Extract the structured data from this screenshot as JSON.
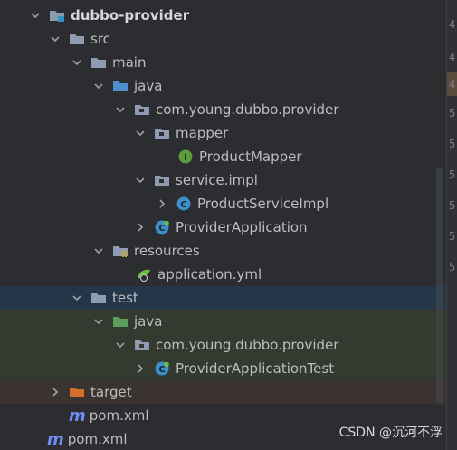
{
  "tree": {
    "rows": [
      {
        "label": "dubbo-provider"
      },
      {
        "label": "src"
      },
      {
        "label": "main"
      },
      {
        "label": "java"
      },
      {
        "label": "com.young.dubbo.provider"
      },
      {
        "label": "mapper"
      },
      {
        "label": "ProductMapper"
      },
      {
        "label": "service.impl"
      },
      {
        "label": "ProductServiceImpl"
      },
      {
        "label": "ProviderApplication"
      },
      {
        "label": "resources"
      },
      {
        "label": "application.yml"
      },
      {
        "label": "test"
      },
      {
        "label": "java"
      },
      {
        "label": "com.young.dubbo.provider"
      },
      {
        "label": "ProviderApplicationTest"
      },
      {
        "label": "target"
      },
      {
        "label": "pom.xml"
      },
      {
        "label": "pom.xml"
      }
    ]
  },
  "gutter": {
    "line_numbers": [
      "4",
      "4",
      "4",
      "5",
      "5",
      "5",
      "5",
      "5",
      "5"
    ]
  },
  "watermark": "CSDN @沉河不浮",
  "colors": {
    "folder": "#8e9bb0",
    "source_folder": "#4f8fd0",
    "test_folder": "#5c9e5c",
    "excluded_folder": "#d56d2b",
    "interface_icon": "#5c9e3c",
    "class_icon": "#3d8fc6",
    "selection": "#24364a"
  },
  "icons": {
    "expanded": "chevron-down-icon",
    "collapsed": "chevron-right-icon"
  }
}
